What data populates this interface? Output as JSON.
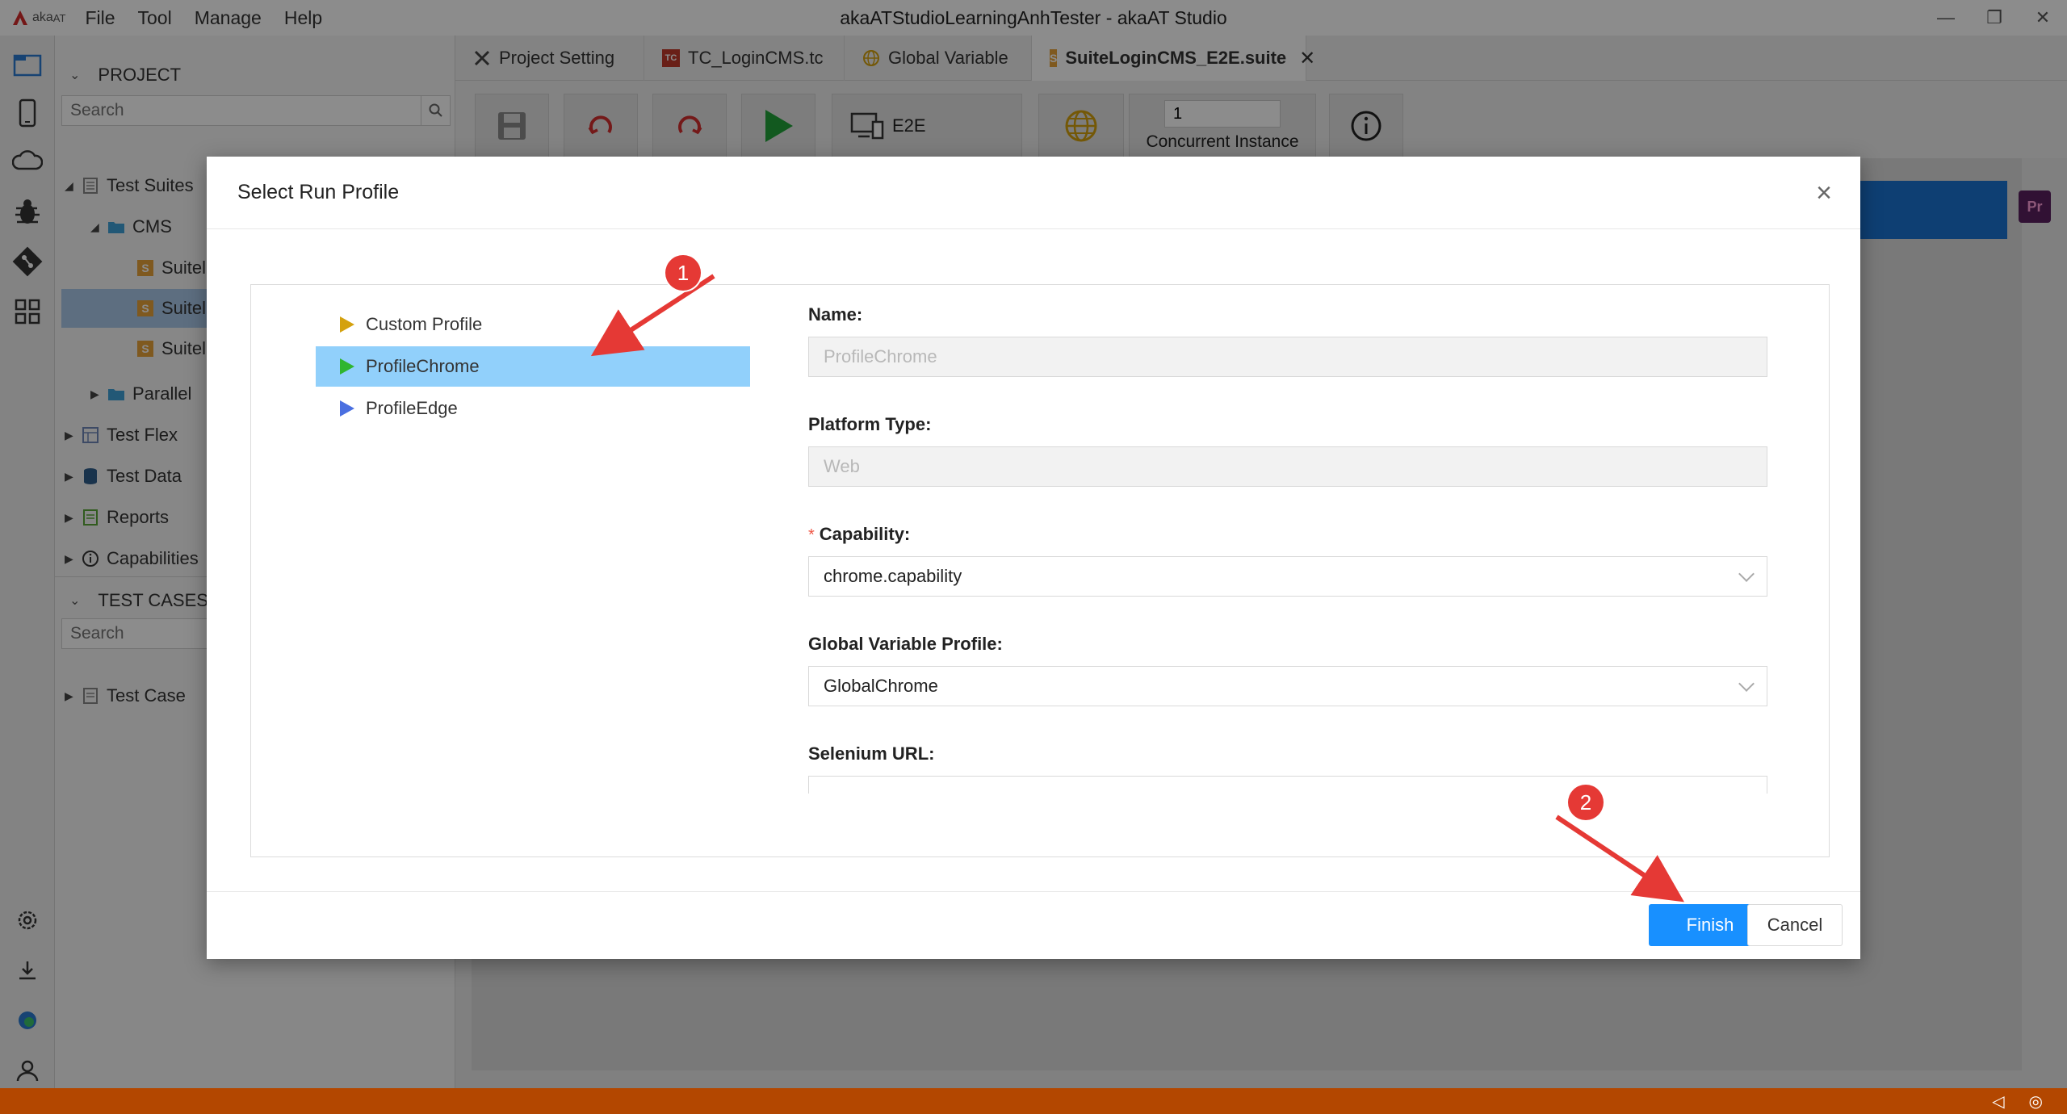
{
  "app": {
    "logo_text": "aka",
    "logo_suffix": "AT",
    "window_title": "akaATStudioLearningAnhTester - akaAT Studio",
    "menu": [
      "File",
      "Tool",
      "Manage",
      "Help"
    ]
  },
  "sidebar": {
    "project_header": "PROJECT",
    "search_placeholder": "Search",
    "tree": [
      {
        "label": "Test Suites",
        "icon": "suite-icon"
      },
      {
        "label": "CMS",
        "icon": "folder-icon"
      },
      {
        "label": "Suitel",
        "icon": "suite-file-icon"
      },
      {
        "label": "Suitel",
        "icon": "suite-file-icon"
      },
      {
        "label": "Suitel",
        "icon": "suite-file-icon"
      },
      {
        "label": "Parallel",
        "icon": "folder-icon"
      },
      {
        "label": "Test Flex",
        "icon": "flex-icon"
      },
      {
        "label": "Test Data",
        "icon": "database-icon"
      },
      {
        "label": "Reports",
        "icon": "report-icon"
      },
      {
        "label": "Capabilities",
        "icon": "info-icon"
      }
    ],
    "testcases_header": "TEST CASES",
    "testcases_search_placeholder": "Search",
    "testcase_item": "Test Case"
  },
  "tabs": [
    {
      "label": "Project Setting",
      "icon": "wrench-icon"
    },
    {
      "label": "TC_LoginCMS.tc",
      "icon": "tc-icon",
      "badge": "TC"
    },
    {
      "label": "Global Variable",
      "icon": "globe-icon"
    },
    {
      "label": "SuiteLoginCMS_E2E.suite",
      "icon": "suite-icon",
      "badge": "S",
      "active": true
    }
  ],
  "toolbar": {
    "run_mode": "E2E",
    "concurrent_value": "1",
    "concurrent_label": "Concurrent Instance",
    "pr_badge": "Pr"
  },
  "modal": {
    "title": "Select Run Profile",
    "profiles": [
      {
        "label": "Custom Profile",
        "color": "#d4a10e"
      },
      {
        "label": "ProfileChrome",
        "color": "#2fb52f",
        "selected": true
      },
      {
        "label": "ProfileEdge",
        "color": "#4a6fe0"
      }
    ],
    "fields": {
      "name_label": "Name:",
      "name_value": "ProfileChrome",
      "platform_label": "Platform Type:",
      "platform_value": "Web",
      "capability_required": "*",
      "capability_label": "Capability:",
      "capability_value": "chrome.capability",
      "global_label": "Global Variable Profile:",
      "global_value": "GlobalChrome",
      "selenium_label": "Selenium URL:",
      "selenium_value": ""
    },
    "finish_label": "Finish",
    "cancel_label": "Cancel"
  },
  "annotations": {
    "step1": "1",
    "step2": "2",
    "color": "#e53935"
  }
}
